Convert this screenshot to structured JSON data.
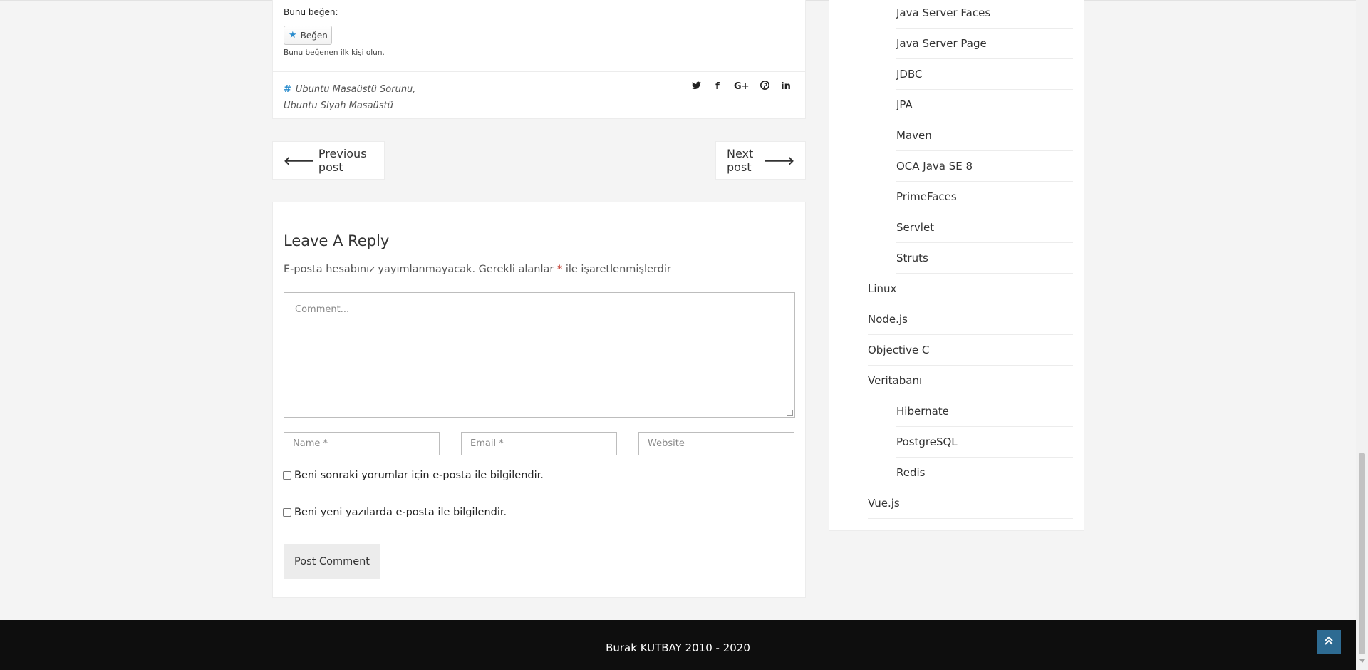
{
  "post": {
    "like_title": "Bunu beğen:",
    "like_button": "Beğen",
    "like_icon": "star-icon",
    "like_note": "Bunu beğenen ilk kişi olun.",
    "tags": [
      "Ubuntu Masaüstü Sorunu,",
      "Ubuntu Siyah Masaüstü"
    ],
    "share_icons": [
      "twitter-icon",
      "facebook-icon",
      "google-plus-icon",
      "pinterest-icon",
      "linkedin-icon"
    ],
    "share_glyphs": [
      "🐦",
      "f",
      "G+",
      "P",
      "in"
    ]
  },
  "nav": {
    "previous": "Previous post",
    "next": "Next post"
  },
  "reply": {
    "title": "Leave A Reply",
    "note": "E-posta hesabınız yayımlanmayacak. Gerekli alanlar",
    "required_mark": "*",
    "note_tail": "ile işaretlenmişlerdir",
    "comment_placeholder": "Comment...",
    "name_placeholder": "Name *",
    "email_placeholder": "Email *",
    "website_placeholder": "Website",
    "check_followup": "Beni sonraki yorumlar için e-posta ile bilgilendir.",
    "check_new_posts": "Beni yeni yazılarda e-posta ile bilgilendir.",
    "submit": "Post Comment"
  },
  "sidebar": {
    "categories": [
      {
        "label": "Java Server Faces",
        "level": "sub"
      },
      {
        "label": "Java Server Page",
        "level": "sub"
      },
      {
        "label": "JDBC",
        "level": "sub"
      },
      {
        "label": "JPA",
        "level": "sub"
      },
      {
        "label": "Maven",
        "level": "sub"
      },
      {
        "label": "OCA Java SE 8",
        "level": "sub"
      },
      {
        "label": "PrimeFaces",
        "level": "sub"
      },
      {
        "label": "Servlet",
        "level": "sub"
      },
      {
        "label": "Struts",
        "level": "sub"
      },
      {
        "label": "Linux",
        "level": "top"
      },
      {
        "label": "Node.js",
        "level": "top"
      },
      {
        "label": "Objective C",
        "level": "top"
      },
      {
        "label": "Veritabanı",
        "level": "top"
      },
      {
        "label": "Hibernate",
        "level": "sub"
      },
      {
        "label": "PostgreSQL",
        "level": "sub"
      },
      {
        "label": "Redis",
        "level": "sub"
      },
      {
        "label": "Vue.js",
        "level": "top"
      }
    ]
  },
  "footer": {
    "copyright": "Burak KUTBAY 2010 - 2020",
    "back_to_top_icon": "double-chevron-up-icon"
  },
  "colors": {
    "accent": "#2a8ccd",
    "footer_bg": "#0e0e0e",
    "back_to_top_bg": "#2e6b92"
  }
}
